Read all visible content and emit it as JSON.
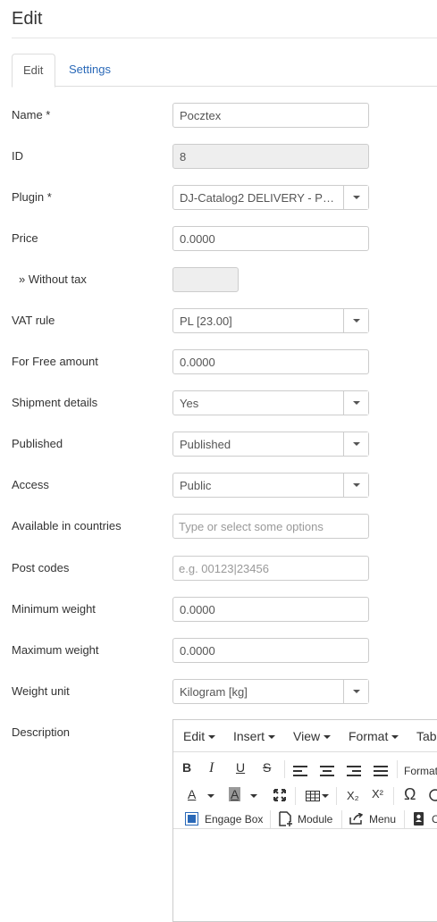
{
  "page": {
    "title": "Edit"
  },
  "tabs": [
    {
      "label": "Edit",
      "active": true
    },
    {
      "label": "Settings",
      "active": false
    }
  ],
  "fields": {
    "name": {
      "label": "Name *",
      "value": "Pocztex"
    },
    "id": {
      "label": "ID",
      "value": "8"
    },
    "plugin": {
      "label": "Plugin *",
      "value": "DJ-Catalog2 DELIVERY - PO..."
    },
    "price": {
      "label": "Price",
      "value": "0.0000"
    },
    "without_tax": {
      "label": "» Without tax",
      "value": ""
    },
    "vat_rule": {
      "label": "VAT rule",
      "value": "PL [23.00]"
    },
    "free_amount": {
      "label": "For Free amount",
      "value": "0.0000"
    },
    "shipment_details": {
      "label": "Shipment details",
      "value": "Yes"
    },
    "published": {
      "label": "Published",
      "value": "Published"
    },
    "access": {
      "label": "Access",
      "value": "Public"
    },
    "countries": {
      "label": "Available in countries",
      "placeholder": "Type or select some options"
    },
    "post_codes": {
      "label": "Post codes",
      "placeholder": "e.g. 00123|23456"
    },
    "min_weight": {
      "label": "Minimum weight",
      "value": "0.0000"
    },
    "max_weight": {
      "label": "Maximum weight",
      "value": "0.0000"
    },
    "weight_unit": {
      "label": "Weight unit",
      "value": "Kilogram [kg]"
    },
    "description": {
      "label": "Description"
    }
  },
  "editor": {
    "menubar": [
      "Edit",
      "Insert",
      "View",
      "Format",
      "Tab"
    ],
    "format_label": "Format",
    "buttons": {
      "engage_box": "Engage Box",
      "module": "Module",
      "menu": "Menu",
      "contact": "C"
    },
    "icons": {
      "bold": "B",
      "italic": "I",
      "underline": "U",
      "strike": "S",
      "font_color": "A",
      "bg_color": "A",
      "subscript": "X₂",
      "superscript": "X²",
      "omega": "Ω"
    }
  }
}
